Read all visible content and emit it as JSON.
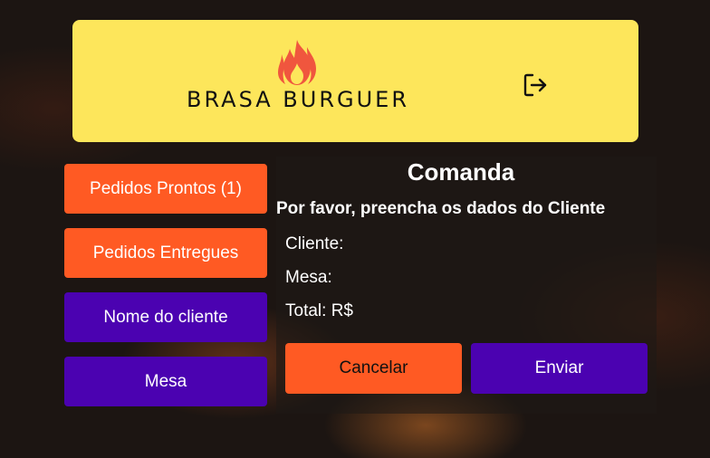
{
  "header": {
    "logo_text": "BRASA BURGUER",
    "logout_icon": "logout-icon"
  },
  "sidebar": {
    "items": [
      {
        "label": "Pedidos Prontos (1)",
        "color": "#ff5a23"
      },
      {
        "label": "Pedidos Entregues",
        "color": "#ff5a23"
      },
      {
        "label": "Nome do cliente",
        "color": "#4b02b1"
      },
      {
        "label": "Mesa",
        "color": "#4b02b1"
      }
    ]
  },
  "comanda": {
    "title": "Comanda",
    "subtitle": "Por favor, preencha os dados do Cliente",
    "cliente_label": "Cliente:",
    "mesa_label": "Mesa:",
    "total_label": "Total: R$",
    "cancel_label": "Cancelar",
    "send_label": "Enviar"
  },
  "colors": {
    "banner": "#fde65b",
    "accent_orange": "#ff5a23",
    "accent_purple": "#4b02b1"
  }
}
